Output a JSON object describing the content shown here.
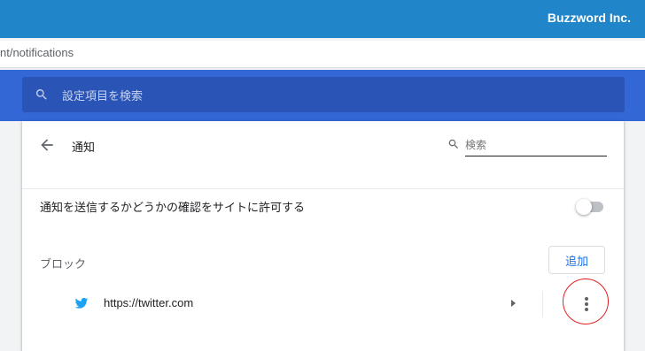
{
  "brand": {
    "name": "Buzzword Inc."
  },
  "address_bar": {
    "url_fragment": "nt/notifications"
  },
  "settings_search": {
    "placeholder": "設定項目を検索",
    "icon": "search-icon"
  },
  "page": {
    "title": "通知",
    "back_icon": "arrow-back-icon",
    "search": {
      "placeholder": "検索",
      "value": ""
    }
  },
  "ask_setting": {
    "label": "通知を送信するかどうかの確認をサイトに許可する",
    "enabled": false
  },
  "block_section": {
    "heading": "ブロック",
    "add_label": "追加",
    "sites": [
      {
        "url": "https://twitter.com",
        "icon": "twitter-icon"
      }
    ]
  },
  "colors": {
    "brand_bar": "#2185c9",
    "header": "#3367d6",
    "search_box": "#2a55b6",
    "accent": "#1a73e8",
    "twitter": "#1da1f2",
    "highlight": "#e02020"
  }
}
